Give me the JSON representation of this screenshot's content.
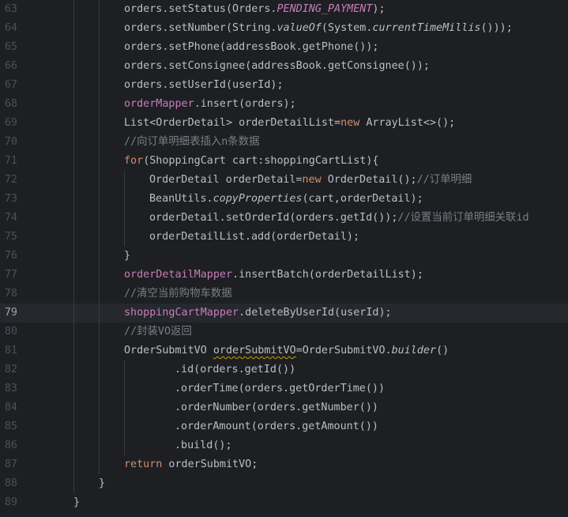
{
  "editor": {
    "current_line": "79",
    "lines": [
      {
        "num": "63",
        "indent": 2,
        "tokens": [
          {
            "t": "orders.setStatus(Orders."
          },
          {
            "t": "PENDING_PAYMENT",
            "c": "const"
          },
          {
            "t": ");"
          }
        ]
      },
      {
        "num": "64",
        "indent": 2,
        "tokens": [
          {
            "t": "orders.setNumber(String."
          },
          {
            "t": "valueOf",
            "c": "st"
          },
          {
            "t": "(System."
          },
          {
            "t": "currentTimeMillis",
            "c": "st"
          },
          {
            "t": "()));"
          }
        ]
      },
      {
        "num": "65",
        "indent": 2,
        "tokens": [
          {
            "t": "orders.setPhone(addressBook.getPhone());"
          }
        ]
      },
      {
        "num": "66",
        "indent": 2,
        "tokens": [
          {
            "t": "orders.setConsignee(addressBook.getConsignee());"
          }
        ]
      },
      {
        "num": "67",
        "indent": 2,
        "tokens": [
          {
            "t": "orders.setUserId(userId);"
          }
        ]
      },
      {
        "num": "68",
        "indent": 2,
        "tokens": [
          {
            "t": "orderMapper",
            "c": "fld"
          },
          {
            "t": ".insert(orders);"
          }
        ]
      },
      {
        "num": "69",
        "indent": 2,
        "tokens": [
          {
            "t": "List<OrderDetail> orderDetailList="
          },
          {
            "t": "new",
            "c": "kw"
          },
          {
            "t": " ArrayList<>();"
          }
        ]
      },
      {
        "num": "70",
        "indent": 2,
        "tokens": [
          {
            "t": "//向订单明细表插入n条数据",
            "c": "cm"
          }
        ]
      },
      {
        "num": "71",
        "indent": 2,
        "tokens": [
          {
            "t": "for",
            "c": "kw"
          },
          {
            "t": "(ShoppingCart cart:shoppingCartList){"
          }
        ]
      },
      {
        "num": "72",
        "indent": 3,
        "tokens": [
          {
            "t": "OrderDetail orderDetail="
          },
          {
            "t": "new",
            "c": "kw"
          },
          {
            "t": " OrderDetail();"
          },
          {
            "t": "//订单明细",
            "c": "cm"
          }
        ]
      },
      {
        "num": "73",
        "indent": 3,
        "tokens": [
          {
            "t": "BeanUtils."
          },
          {
            "t": "copyProperties",
            "c": "st"
          },
          {
            "t": "(cart,orderDetail);"
          }
        ]
      },
      {
        "num": "74",
        "indent": 3,
        "tokens": [
          {
            "t": "orderDetail.setOrderId(orders.getId());"
          },
          {
            "t": "//设置当前订单明细关联id",
            "c": "cm"
          }
        ]
      },
      {
        "num": "75",
        "indent": 3,
        "tokens": [
          {
            "t": "orderDetailList.add(orderDetail);"
          }
        ]
      },
      {
        "num": "76",
        "indent": 2,
        "tokens": [
          {
            "t": "}"
          }
        ]
      },
      {
        "num": "77",
        "indent": 2,
        "tokens": [
          {
            "t": "orderDetailMapper",
            "c": "fld"
          },
          {
            "t": ".insertBatch(orderDetailList);"
          }
        ]
      },
      {
        "num": "78",
        "indent": 2,
        "tokens": [
          {
            "t": "//清空当前购物车数据",
            "c": "cm"
          }
        ]
      },
      {
        "num": "79",
        "indent": 2,
        "tokens": [
          {
            "t": "shoppingCartMapper",
            "c": "fld"
          },
          {
            "t": ".deleteByUserId(userId);"
          }
        ]
      },
      {
        "num": "80",
        "indent": 2,
        "tokens": [
          {
            "t": "//封装VO返回",
            "c": "cm"
          }
        ]
      },
      {
        "num": "81",
        "indent": 2,
        "tokens": [
          {
            "t": "OrderSubmitVO "
          },
          {
            "t": "orderSubmitVO",
            "c": "warn"
          },
          {
            "t": "=OrderSubmitVO."
          },
          {
            "t": "builder",
            "c": "st"
          },
          {
            "t": "()"
          }
        ]
      },
      {
        "num": "82",
        "indent": 4,
        "tokens": [
          {
            "t": ".id(orders.getId())"
          }
        ]
      },
      {
        "num": "83",
        "indent": 4,
        "tokens": [
          {
            "t": ".orderTime(orders.getOrderTime())"
          }
        ]
      },
      {
        "num": "84",
        "indent": 4,
        "tokens": [
          {
            "t": ".orderNumber(orders.getNumber())"
          }
        ]
      },
      {
        "num": "85",
        "indent": 4,
        "tokens": [
          {
            "t": ".orderAmount(orders.getAmount())"
          }
        ]
      },
      {
        "num": "86",
        "indent": 4,
        "tokens": [
          {
            "t": ".build();"
          }
        ]
      },
      {
        "num": "87",
        "indent": 2,
        "tokens": [
          {
            "t": "return",
            "c": "kw"
          },
          {
            "t": " orderSubmitVO;"
          }
        ]
      },
      {
        "num": "88",
        "indent": 1,
        "tokens": [
          {
            "t": "}"
          }
        ]
      },
      {
        "num": "89",
        "indent": 0,
        "tokens": [
          {
            "t": "}"
          }
        ]
      }
    ]
  }
}
